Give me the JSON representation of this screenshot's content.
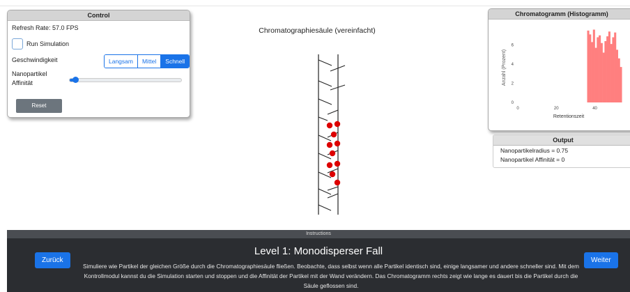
{
  "control": {
    "title": "Control",
    "refresh_rate": "Refresh Rate: 57.0 FPS",
    "run_label": "Run Simulation",
    "run_checked": false,
    "speed_label": "Geschwindigkeit",
    "speed_options": [
      "Langsam",
      "Mittel",
      "Schnell"
    ],
    "speed_selected": "Schnell",
    "affinity_label_1": "Nanopartikel",
    "affinity_label_2": "Affinität",
    "affinity_value": 0,
    "reset_label": "Reset"
  },
  "column": {
    "title": "Chromatographiesäule (vereinfacht)"
  },
  "chromatogram": {
    "title": "Chromatogramm (Histogramm)"
  },
  "chart_data": {
    "type": "bar",
    "title": "",
    "xlabel": "Retentionszeit",
    "ylabel": "Anzahl (Prozent)",
    "xlim": [
      0,
      55
    ],
    "ylim": [
      0,
      8
    ],
    "xticks": [
      0,
      20,
      40
    ],
    "yticks": [
      0,
      2,
      4,
      6
    ],
    "bar_color": "#ff7f7f",
    "x": [
      36,
      37,
      38,
      39,
      40,
      41,
      42,
      43,
      44,
      45,
      46,
      47,
      48,
      49,
      50,
      51,
      52,
      53
    ],
    "values": [
      7.5,
      7.1,
      6.3,
      7.6,
      5.7,
      6.8,
      7.0,
      6.2,
      5.2,
      6.4,
      6.9,
      7.4,
      6.1,
      6.8,
      7.3,
      5.5,
      4.6,
      3.7
    ]
  },
  "output": {
    "title": "Output",
    "radius": "Nanopartikelradius = 0.75",
    "affinity": "Nanopartikel Affinität = 0"
  },
  "instructions": {
    "header": "Instructions",
    "title": "Level 1: Monodisperser Fall",
    "body": "Simuliere wie Partikel der gleichen Größe durch die Chromatographiesäule fließen. Beobachte, dass selbst wenn alle Partikel identisch sind, einige langsamer und andere schneller sind. Mit dem Kontrollmodul kannst du die Simulation starten und stoppen und die Affinität der Partikel mit der Wand verändern. Das Chromatogramm rechts zeigt wie lange es dauert bis die Partikel durch die Säule geflossen sind.",
    "back_label": "Zurück",
    "next_label": "Weiter"
  },
  "colors": {
    "accent": "#1a73e8",
    "particle": "#dd0000"
  }
}
